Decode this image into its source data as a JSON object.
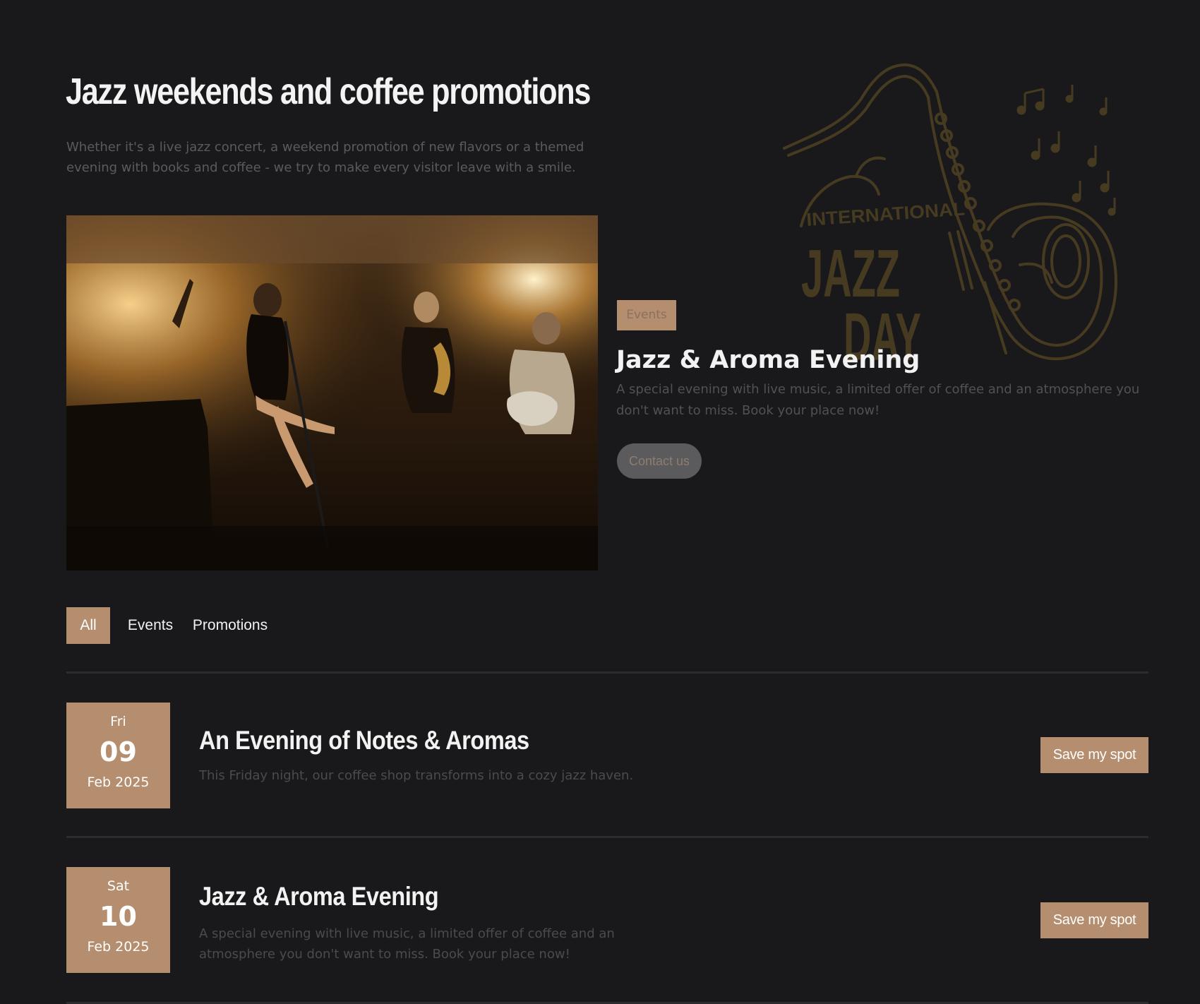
{
  "header": {
    "title": "Jazz weekends and coffee promotions",
    "intro": "Whether it's a live jazz concert, a weekend promotion of new flavors or a themed evening with books and coffee - we try to make every visitor leave with a smile."
  },
  "illustration": {
    "line1": "INTERNATIONAL",
    "line2": "JAZZ",
    "line3": "DAY",
    "icon": "saxophone-icon"
  },
  "featured": {
    "tag": "Events",
    "title": "Jazz & Aroma Evening",
    "description": "A special evening with live music, a limited offer of coffee and an atmosphere you don't want to miss. Book your place now!",
    "cta": "Contact us"
  },
  "filters": {
    "tabs": [
      {
        "label": "All",
        "active": true
      },
      {
        "label": "Events",
        "active": false
      },
      {
        "label": "Promotions",
        "active": false
      }
    ]
  },
  "events": [
    {
      "dow": "Fri",
      "day": "09",
      "month": "Feb 2025",
      "title": "An Evening of Notes & Aromas",
      "description": "This Friday night, our coffee shop transforms into a cozy jazz haven.",
      "cta": "Save my spot"
    },
    {
      "dow": "Sat",
      "day": "10",
      "month": "Feb 2025",
      "title": "Jazz & Aroma Evening",
      "description": "A special evening with live music, a limited offer of coffee and an atmosphere you don't want to miss. Book your place now!",
      "cta": "Save my spot"
    }
  ],
  "colors": {
    "background": "#19191c",
    "accent": "#b58e6f",
    "illustration": "#463b20"
  }
}
